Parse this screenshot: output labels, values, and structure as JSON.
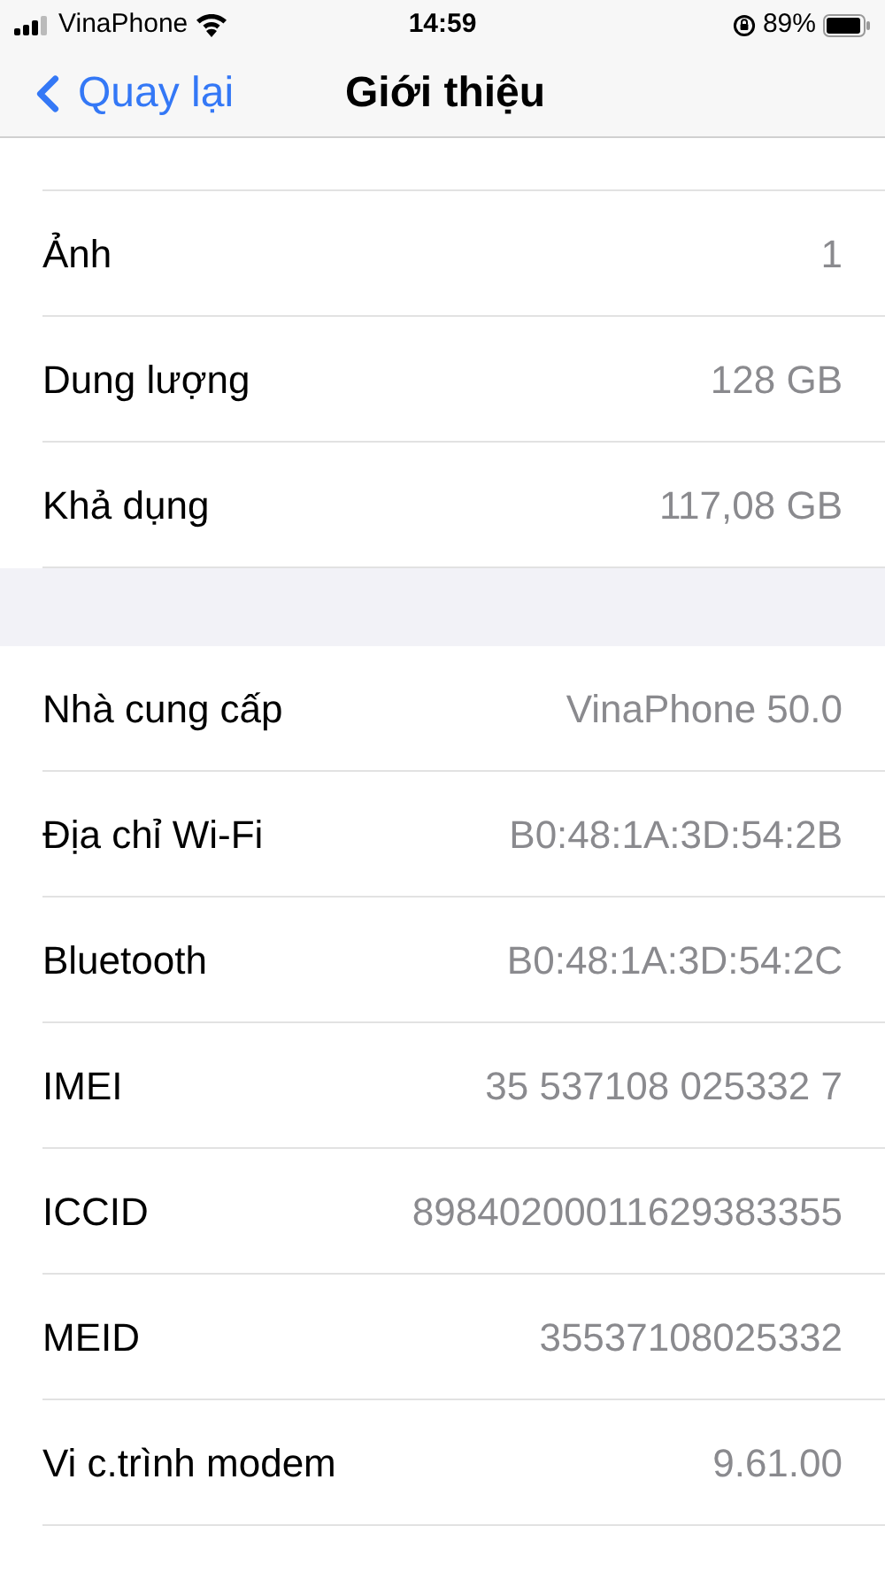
{
  "status_bar": {
    "carrier": "VinaPhone",
    "time": "14:59",
    "battery": "89%"
  },
  "nav": {
    "back": "Quay lại",
    "title": "Giới thiệu"
  },
  "sections": [
    {
      "rows": [
        {
          "label": "Ảnh",
          "value": "1"
        },
        {
          "label": "Dung lượng",
          "value": "128 GB"
        },
        {
          "label": "Khả dụng",
          "value": "117,08 GB"
        }
      ]
    },
    {
      "rows": [
        {
          "label": "Nhà cung cấp",
          "value": "VinaPhone 50.0"
        },
        {
          "label": "Địa chỉ Wi-Fi",
          "value": "B0:48:1A:3D:54:2B"
        },
        {
          "label": "Bluetooth",
          "value": "B0:48:1A:3D:54:2C"
        },
        {
          "label": "IMEI",
          "value": "35 537108 025332 7"
        },
        {
          "label": "ICCID",
          "value": "89840200011629383355"
        },
        {
          "label": "MEID",
          "value": "35537108025332"
        },
        {
          "label": "Vi c.trình modem",
          "value": "9.61.00"
        }
      ]
    }
  ]
}
